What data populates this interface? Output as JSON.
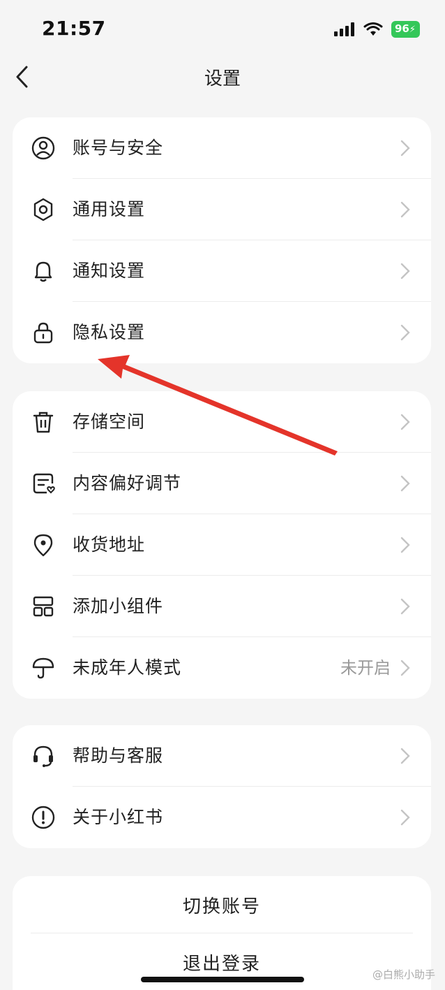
{
  "status": {
    "time": "21:57",
    "battery": "96"
  },
  "nav": {
    "title": "设置"
  },
  "group1": [
    {
      "label": "账号与安全",
      "icon": "user-icon"
    },
    {
      "label": "通用设置",
      "icon": "gear-icon"
    },
    {
      "label": "通知设置",
      "icon": "bell-icon"
    },
    {
      "label": "隐私设置",
      "icon": "lock-icon"
    }
  ],
  "group2": [
    {
      "label": "存储空间",
      "icon": "trash-icon"
    },
    {
      "label": "内容偏好调节",
      "icon": "content-preference-icon"
    },
    {
      "label": "收货地址",
      "icon": "location-icon"
    },
    {
      "label": "添加小组件",
      "icon": "widget-icon"
    },
    {
      "label": "未成年人模式",
      "icon": "umbrella-icon",
      "value": "未开启"
    }
  ],
  "group3": [
    {
      "label": "帮助与客服",
      "icon": "headset-icon"
    },
    {
      "label": "关于小红书",
      "icon": "info-icon"
    }
  ],
  "actions": {
    "switch_account": "切换账号",
    "logout": "退出登录"
  },
  "watermark": "@白熊小助手",
  "colors": {
    "background": "#f5f5f5",
    "card": "#ffffff",
    "battery": "#34c759",
    "annotation_arrow": "#e4342a"
  }
}
